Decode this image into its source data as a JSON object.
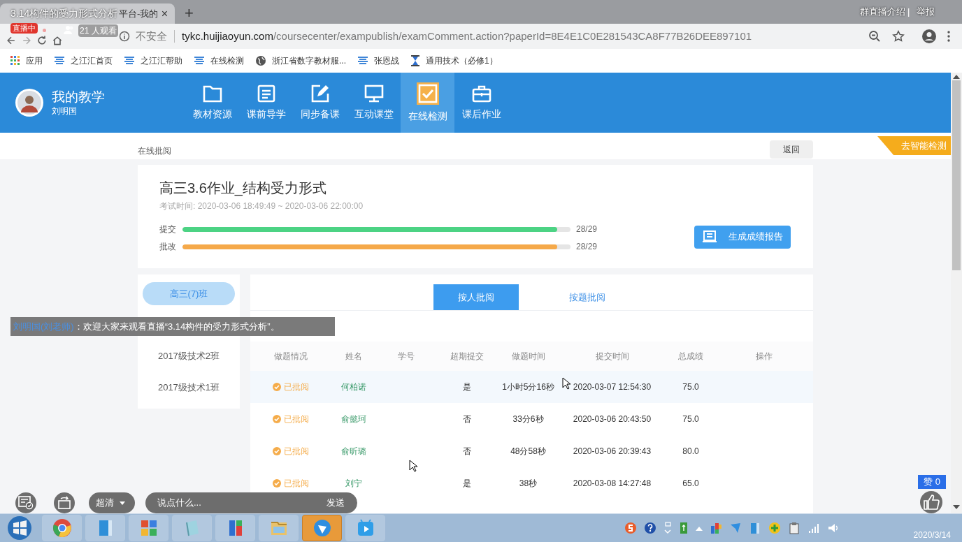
{
  "browser": {
    "tab_title": "平台-我的",
    "tab_close": "×",
    "new_tab": "+",
    "security": "不安全",
    "url_host": "tykc.huijiaoyun.com",
    "url_path": "/coursecenter/exampublish/examComment.action?paperId=8E4E1C0E281543CA8F77B26DEE897101",
    "bookmarks": [
      {
        "label": "应用",
        "kind": "apps"
      },
      {
        "label": "之江汇首页",
        "kind": "site"
      },
      {
        "label": "之江汇帮助",
        "kind": "site"
      },
      {
        "label": "在线检测",
        "kind": "site"
      },
      {
        "label": "浙江省数字教材服...",
        "kind": "globe"
      },
      {
        "label": "张恩战",
        "kind": "site"
      },
      {
        "label": "通用技术（必修1）",
        "kind": "hourglass"
      }
    ]
  },
  "stream": {
    "title": "3.14构件的受力形式分析",
    "live_badge": "直播中",
    "viewers": "21 人观看",
    "intro_link": "群直播介绍",
    "separator": "|",
    "report_link": "举报"
  },
  "header": {
    "title": "我的教学",
    "user": "刘明国",
    "nav": [
      {
        "label": "教材资源",
        "kind": "folder",
        "selected": false
      },
      {
        "label": "课前导学",
        "kind": "document",
        "selected": false
      },
      {
        "label": "同步备课",
        "kind": "edit",
        "selected": false
      },
      {
        "label": "互动课堂",
        "kind": "monitor",
        "selected": false
      },
      {
        "label": "在线检测",
        "kind": "check",
        "selected": true
      },
      {
        "label": "课后作业",
        "kind": "briefcase",
        "selected": false
      }
    ]
  },
  "breadcrumb": "在线批阅",
  "back_button": "返回",
  "smart_ribbon": "去智能检测",
  "exam": {
    "title": "高三3.6作业_结构受力形式",
    "time": "考试时间: 2020-03-06 18:49:49 ~ 2020-03-06 22:00:00",
    "progress": [
      {
        "label": "提交",
        "level": 0.9655,
        "reading": "28/29",
        "color": "#4cd384"
      },
      {
        "label": "批改",
        "level": 0.9655,
        "reading": "28/29",
        "color": "#f5a94a"
      }
    ],
    "report_button": "生成成绩报告"
  },
  "classes": [
    {
      "label": "高三(7)班",
      "selected": true
    },
    {
      "label": "2017级技术2班",
      "selected": false
    },
    {
      "label": "2017级技术1班",
      "selected": false
    }
  ],
  "review_tabs": [
    {
      "label": "按人批阅",
      "selected": true
    },
    {
      "label": "按题批阅",
      "selected": false
    }
  ],
  "table": {
    "columns": [
      "做题情况",
      "姓名",
      "学号",
      "超期提交",
      "做题时间",
      "提交时间",
      "总成绩",
      "操作"
    ],
    "rows": [
      {
        "status": "已批阅",
        "name": "何柏诺",
        "overdue": "是",
        "duration": "1小时5分16秒",
        "submitted": "2020-03-07 12:54:30",
        "score": "75.0",
        "highlighted": true
      },
      {
        "status": "已批阅",
        "name": "俞懿珂",
        "overdue": "否",
        "duration": "33分6秒",
        "submitted": "2020-03-06 20:43:50",
        "score": "75.0",
        "highlighted": false
      },
      {
        "status": "已批阅",
        "name": "俞昕璐",
        "overdue": "否",
        "duration": "48分58秒",
        "submitted": "2020-03-06 20:39:43",
        "score": "80.0",
        "highlighted": false
      },
      {
        "status": "已批阅",
        "name": "刘宁",
        "overdue": "是",
        "duration": "38秒",
        "submitted": "2020-03-08 14:27:48",
        "score": "65.0",
        "highlighted": false
      }
    ]
  },
  "chat": {
    "sender": "刘明国(刘老师)",
    "message": "：欢迎大家来观看直播“3.14构件的受力形式分析”。"
  },
  "player": {
    "quality": "超清",
    "comment_placeholder": "说点什么...",
    "send": "发送",
    "likes": "赞 0"
  },
  "taskbar": {
    "date": "2020/3/14"
  }
}
